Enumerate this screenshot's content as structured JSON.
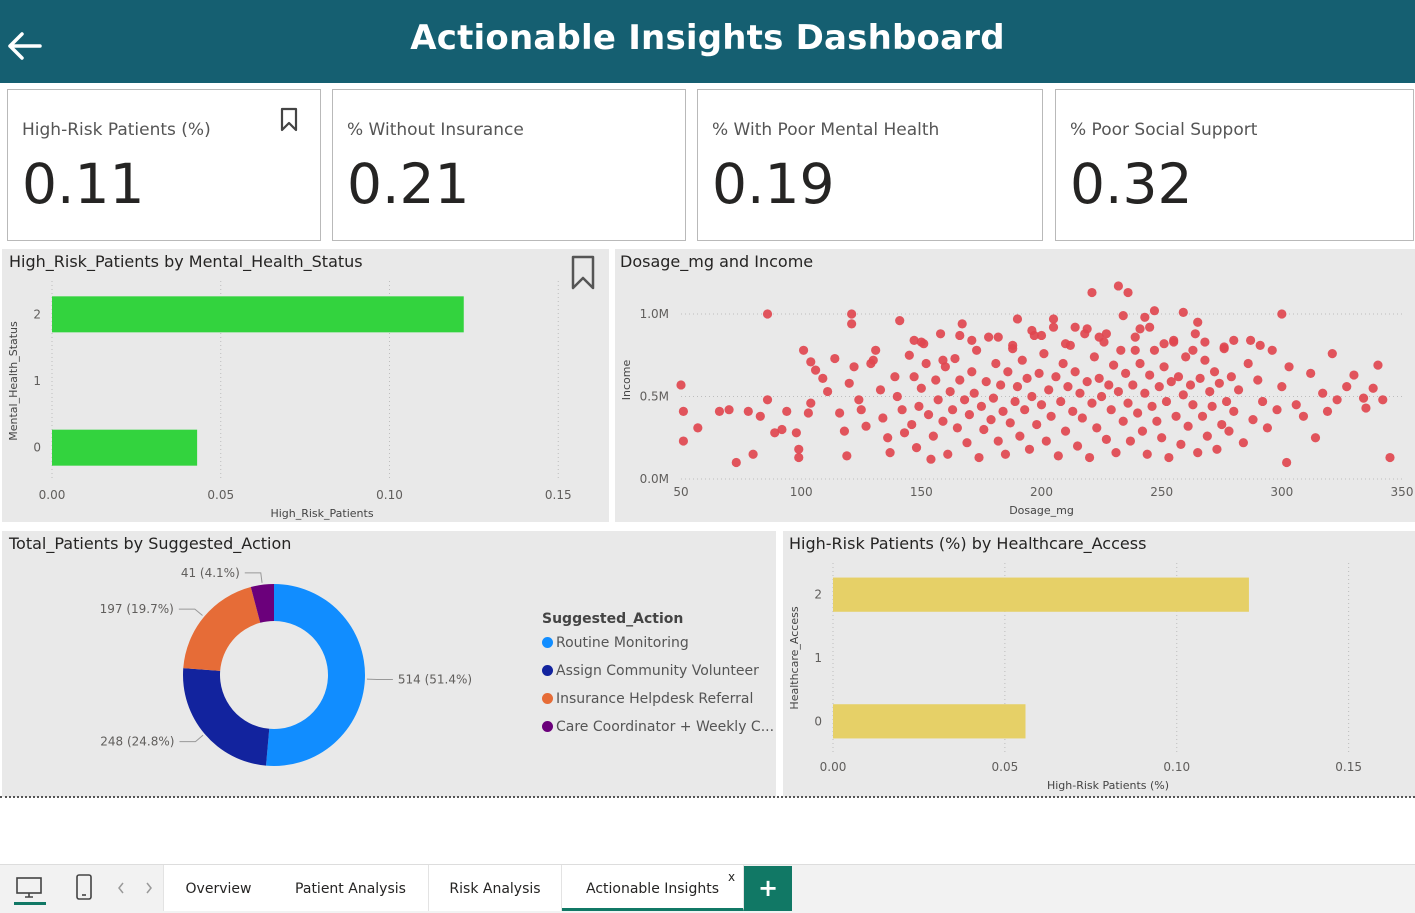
{
  "header": {
    "title": "Actionable Insights Dashboard"
  },
  "cards": [
    {
      "label": "High-Risk Patients (%)",
      "value": "0.11"
    },
    {
      "label": "% Without Insurance",
      "value": "0.21"
    },
    {
      "label": "% With Poor Mental Health",
      "value": "0.19"
    },
    {
      "label": "% Poor Social Support",
      "value": "0.32"
    }
  ],
  "panels": {
    "mental": {
      "title": "High_Risk_Patients by Mental_Health_Status"
    },
    "scatter": {
      "title": "Dosage_mg and Income"
    },
    "donut": {
      "title": "Total_Patients by Suggested_Action"
    },
    "access": {
      "title": "High-Risk Patients (%) by Healthcare_Access"
    }
  },
  "legend": {
    "title": "Suggested_Action"
  },
  "tabs": {
    "items": [
      "Overview",
      "Patient Analysis",
      "Risk Analysis",
      "Actionable Insights"
    ],
    "close": "x",
    "add": "+"
  },
  "colors": {
    "header": "#155f71",
    "green_bar": "#33d33e",
    "yellow_bar": "#e6d067",
    "scatter_point": "#e0474f",
    "tab_accent": "#117865"
  },
  "chart_data": [
    {
      "type": "bar",
      "orientation": "horizontal",
      "title": "High_Risk_Patients by Mental_Health_Status",
      "xlabel": "High_Risk_Patients",
      "ylabel": "Mental_Health_Status",
      "categories": [
        "2",
        "1",
        "0"
      ],
      "values": [
        0.122,
        0,
        0.043
      ],
      "xlim": [
        0,
        0.16
      ],
      "xticks": [
        "0.00",
        "0.05",
        "0.10",
        "0.15"
      ],
      "color": "#33d33e"
    },
    {
      "type": "scatter",
      "title": "Dosage_mg and Income",
      "xlabel": "Dosage_mg",
      "ylabel": "Income",
      "xlim": [
        50,
        350
      ],
      "ylim": [
        0,
        1200000
      ],
      "xticks": [
        "50",
        "100",
        "150",
        "200",
        "250",
        "300",
        "350"
      ],
      "yticks": [
        "0.0M",
        "0.5M",
        "1.0M"
      ],
      "color": "#e0474f",
      "points": [
        [
          50,
          570000
        ],
        [
          51,
          410000
        ],
        [
          51,
          230000
        ],
        [
          57,
          310000
        ],
        [
          66,
          410000
        ],
        [
          70,
          420000
        ],
        [
          73,
          100000
        ],
        [
          78,
          410000
        ],
        [
          80,
          150000
        ],
        [
          83,
          380000
        ],
        [
          86,
          480000
        ],
        [
          89,
          280000
        ],
        [
          92,
          300000
        ],
        [
          94,
          410000
        ],
        [
          98,
          280000
        ],
        [
          99,
          180000
        ],
        [
          99,
          130000
        ],
        [
          103,
          400000
        ],
        [
          104,
          460000
        ],
        [
          106,
          660000
        ],
        [
          109,
          610000
        ],
        [
          111,
          530000
        ],
        [
          114,
          730000
        ],
        [
          116,
          400000
        ],
        [
          118,
          290000
        ],
        [
          119,
          140000
        ],
        [
          120,
          580000
        ],
        [
          121,
          940000
        ],
        [
          122,
          680000
        ],
        [
          124,
          480000
        ],
        [
          125,
          420000
        ],
        [
          127,
          320000
        ],
        [
          129,
          700000
        ],
        [
          131,
          780000
        ],
        [
          133,
          540000
        ],
        [
          134,
          370000
        ],
        [
          136,
          250000
        ],
        [
          137,
          160000
        ],
        [
          139,
          620000
        ],
        [
          140,
          500000
        ],
        [
          141,
          960000
        ],
        [
          142,
          420000
        ],
        [
          143,
          280000
        ],
        [
          145,
          750000
        ],
        [
          146,
          330000
        ],
        [
          147,
          620000
        ],
        [
          148,
          190000
        ],
        [
          149,
          440000
        ],
        [
          150,
          550000
        ],
        [
          151,
          820000
        ],
        [
          152,
          700000
        ],
        [
          153,
          390000
        ],
        [
          154,
          120000
        ],
        [
          155,
          260000
        ],
        [
          156,
          600000
        ],
        [
          157,
          480000
        ],
        [
          158,
          880000
        ],
        [
          159,
          350000
        ],
        [
          160,
          680000
        ],
        [
          161,
          150000
        ],
        [
          162,
          530000
        ],
        [
          163,
          420000
        ],
        [
          164,
          730000
        ],
        [
          165,
          310000
        ],
        [
          166,
          600000
        ],
        [
          167,
          940000
        ],
        [
          168,
          480000
        ],
        [
          169,
          220000
        ],
        [
          170,
          390000
        ],
        [
          171,
          650000
        ],
        [
          172,
          520000
        ],
        [
          173,
          780000
        ],
        [
          174,
          130000
        ],
        [
          175,
          440000
        ],
        [
          176,
          300000
        ],
        [
          177,
          590000
        ],
        [
          178,
          860000
        ],
        [
          179,
          360000
        ],
        [
          180,
          490000
        ],
        [
          181,
          700000
        ],
        [
          182,
          230000
        ],
        [
          183,
          570000
        ],
        [
          184,
          410000
        ],
        [
          185,
          150000
        ],
        [
          186,
          650000
        ],
        [
          187,
          340000
        ],
        [
          188,
          810000
        ],
        [
          189,
          470000
        ],
        [
          190,
          560000
        ],
        [
          191,
          260000
        ],
        [
          192,
          720000
        ],
        [
          193,
          420000
        ],
        [
          194,
          610000
        ],
        [
          195,
          180000
        ],
        [
          196,
          500000
        ],
        [
          197,
          870000
        ],
        [
          198,
          330000
        ],
        [
          199,
          640000
        ],
        [
          200,
          450000
        ],
        [
          201,
          760000
        ],
        [
          202,
          230000
        ],
        [
          203,
          540000
        ],
        [
          204,
          380000
        ],
        [
          205,
          920000
        ],
        [
          206,
          620000
        ],
        [
          207,
          140000
        ],
        [
          208,
          470000
        ],
        [
          209,
          700000
        ],
        [
          210,
          290000
        ],
        [
          211,
          560000
        ],
        [
          212,
          810000
        ],
        [
          213,
          410000
        ],
        [
          214,
          650000
        ],
        [
          215,
          200000
        ],
        [
          216,
          520000
        ],
        [
          217,
          370000
        ],
        [
          218,
          880000
        ],
        [
          219,
          590000
        ],
        [
          220,
          130000
        ],
        [
          221,
          460000
        ],
        [
          222,
          740000
        ],
        [
          223,
          310000
        ],
        [
          224,
          610000
        ],
        [
          225,
          500000
        ],
        [
          226,
          830000
        ],
        [
          227,
          240000
        ],
        [
          228,
          570000
        ],
        [
          229,
          420000
        ],
        [
          230,
          690000
        ],
        [
          231,
          160000
        ],
        [
          232,
          530000
        ],
        [
          233,
          780000
        ],
        [
          234,
          350000
        ],
        [
          235,
          640000
        ],
        [
          236,
          460000
        ],
        [
          237,
          230000
        ],
        [
          238,
          570000
        ],
        [
          239,
          860000
        ],
        [
          240,
          400000
        ],
        [
          241,
          700000
        ],
        [
          242,
          290000
        ],
        [
          243,
          520000
        ],
        [
          244,
          150000
        ],
        [
          245,
          630000
        ],
        [
          246,
          440000
        ],
        [
          247,
          780000
        ],
        [
          248,
          350000
        ],
        [
          249,
          560000
        ],
        [
          250,
          250000
        ],
        [
          251,
          680000
        ],
        [
          252,
          470000
        ],
        [
          253,
          130000
        ],
        [
          254,
          590000
        ],
        [
          255,
          830000
        ],
        [
          256,
          380000
        ],
        [
          257,
          620000
        ],
        [
          258,
          210000
        ],
        [
          259,
          510000
        ],
        [
          260,
          740000
        ],
        [
          261,
          320000
        ],
        [
          262,
          570000
        ],
        [
          263,
          450000
        ],
        [
          264,
          880000
        ],
        [
          265,
          160000
        ],
        [
          266,
          610000
        ],
        [
          267,
          380000
        ],
        [
          268,
          720000
        ],
        [
          269,
          260000
        ],
        [
          270,
          530000
        ],
        [
          271,
          440000
        ],
        [
          272,
          650000
        ],
        [
          273,
          180000
        ],
        [
          274,
          580000
        ],
        [
          275,
          330000
        ],
        [
          276,
          790000
        ],
        [
          277,
          470000
        ],
        [
          278,
          290000
        ],
        [
          279,
          620000
        ],
        [
          280,
          410000
        ],
        [
          282,
          540000
        ],
        [
          284,
          220000
        ],
        [
          286,
          700000
        ],
        [
          288,
          360000
        ],
        [
          290,
          600000
        ],
        [
          292,
          470000
        ],
        [
          294,
          310000
        ],
        [
          296,
          780000
        ],
        [
          298,
          420000
        ],
        [
          300,
          560000
        ],
        [
          302,
          100000
        ],
        [
          303,
          680000
        ],
        [
          306,
          450000
        ],
        [
          309,
          380000
        ],
        [
          312,
          640000
        ],
        [
          314,
          250000
        ],
        [
          317,
          520000
        ],
        [
          319,
          410000
        ],
        [
          321,
          760000
        ],
        [
          323,
          480000
        ],
        [
          327,
          560000
        ],
        [
          330,
          630000
        ],
        [
          334,
          490000
        ],
        [
          335,
          430000
        ],
        [
          338,
          550000
        ],
        [
          340,
          690000
        ],
        [
          342,
          480000
        ],
        [
          345,
          130000
        ],
        [
          86,
          1000000
        ],
        [
          101,
          780000
        ],
        [
          104,
          710000
        ],
        [
          121,
          1000000
        ],
        [
          130,
          720000
        ],
        [
          147,
          840000
        ],
        [
          150,
          830000
        ],
        [
          159,
          720000
        ],
        [
          166,
          870000
        ],
        [
          171,
          840000
        ],
        [
          182,
          860000
        ],
        [
          188,
          790000
        ],
        [
          190,
          970000
        ],
        [
          196,
          900000
        ],
        [
          200,
          870000
        ],
        [
          205,
          970000
        ],
        [
          210,
          820000
        ],
        [
          214,
          920000
        ],
        [
          219,
          910000
        ],
        [
          221,
          1130000
        ],
        [
          224,
          860000
        ],
        [
          227,
          880000
        ],
        [
          232,
          1170000
        ],
        [
          234,
          990000
        ],
        [
          236,
          1130000
        ],
        [
          239,
          780000
        ],
        [
          241,
          910000
        ],
        [
          243,
          980000
        ],
        [
          245,
          920000
        ],
        [
          247,
          1020000
        ],
        [
          251,
          820000
        ],
        [
          255,
          840000
        ],
        [
          259,
          1010000
        ],
        [
          263,
          780000
        ],
        [
          265,
          950000
        ],
        [
          268,
          830000
        ],
        [
          276,
          800000
        ],
        [
          280,
          840000
        ],
        [
          287,
          840000
        ],
        [
          291,
          810000
        ],
        [
          300,
          1000000
        ]
      ]
    },
    {
      "type": "pie",
      "subtype": "donut",
      "title": "Total_Patients by Suggested_Action",
      "legend_title": "Suggested_Action",
      "categories": [
        "Routine Monitoring",
        "Assign Community Volunteer",
        "Insurance Helpdesk Referral",
        "Care Coordinator + Weekly C..."
      ],
      "values": [
        514,
        248,
        197,
        41
      ],
      "labels": [
        "514 (51.4%)",
        "248 (24.8%)",
        "197 (19.7%)",
        "41 (4.1%)"
      ],
      "colors": [
        "#118dff",
        "#12239e",
        "#e66c37",
        "#6b007b"
      ],
      "legend_position": "right"
    },
    {
      "type": "bar",
      "orientation": "horizontal",
      "title": "High-Risk Patients (%) by Healthcare_Access",
      "xlabel": "High-Risk Patients (%)",
      "ylabel": "Healthcare_Access",
      "categories": [
        "2",
        "1",
        "0"
      ],
      "values": [
        0.121,
        0,
        0.056
      ],
      "xlim": [
        0,
        0.16
      ],
      "xticks": [
        "0.00",
        "0.05",
        "0.10",
        "0.15"
      ],
      "color": "#e6d067"
    }
  ]
}
